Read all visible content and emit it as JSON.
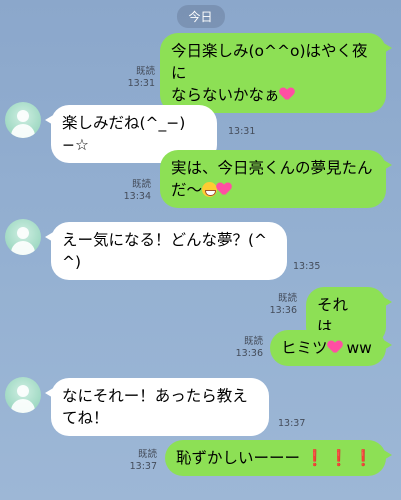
{
  "date_label": "今日",
  "messages": [
    {
      "side": "out",
      "line1": "今日楽しみ(o^^o)はやく夜に",
      "line2": "ならないかなぁ",
      "read": "既読",
      "time": "13:31",
      "emoji": "heart-icon"
    },
    {
      "side": "in",
      "line1": "楽しみだね(^_−)−☆",
      "time": "13:31"
    },
    {
      "side": "out",
      "line1": "実は、今日亮くんの夢見たん",
      "line2": "だ〜",
      "read": "既読",
      "time": "13:34",
      "emoji": "grin-icon, hearts-icon"
    },
    {
      "side": "in",
      "line1": "えー気になる！どんな夢？(^",
      "line2": "^)",
      "time": "13:35"
    },
    {
      "side": "out",
      "line1": "それは…",
      "read": "既読",
      "time": "13:36"
    },
    {
      "side": "out",
      "line1": "ヒミツ",
      "line_suffix": "ww",
      "read": "既読",
      "time": "13:36",
      "emoji": "heart-icon"
    },
    {
      "side": "in",
      "line1": "なにそれー！あったら教え",
      "line2": "てね！",
      "time": "13:37"
    },
    {
      "side": "out",
      "line1": "恥ずかしいーーー",
      "read": "既読",
      "time": "13:37",
      "emoji": "exclamation-icon x3"
    }
  ],
  "colors": {
    "outgoing_bubble": "#8de055",
    "incoming_bubble": "#ffffff",
    "background": "#8ba7cb",
    "accent_exclamation": "#e11111"
  },
  "icons": [
    "heart-icon",
    "grin-icon",
    "avatar-icon"
  ]
}
